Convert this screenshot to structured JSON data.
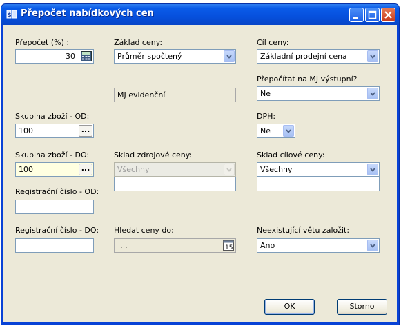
{
  "window": {
    "title": "Přepočet nabídkových cen"
  },
  "colors": {
    "titlebar": "#0650dd",
    "client_bg": "#ece9d8",
    "field_border": "#7f9db9",
    "highlight_field": "#ffffe1"
  },
  "form": {
    "recalc_percent": {
      "label": "Přepočet (%) :",
      "value": "30",
      "button_icon": "calculator-icon"
    },
    "base_price": {
      "label": "Základ ceny:",
      "value": "Průměr spočtený"
    },
    "mj_evidence": {
      "value": "MJ evidenční"
    },
    "target_price": {
      "label": "Cíl ceny:",
      "value": "Základní prodejní cena"
    },
    "recalc_mj": {
      "label": "Přepočítat na MJ výstupní?",
      "value": "Ne"
    },
    "goods_group_from": {
      "label": "Skupina zboží - OD:",
      "value": "100",
      "button": "..."
    },
    "vat": {
      "label": "DPH:",
      "value": "Ne"
    },
    "goods_group_to": {
      "label": "Skupina zboží - DO:",
      "value": "100",
      "button": "..."
    },
    "source_warehouse": {
      "label": "Sklad zdrojové ceny:",
      "value": "Všechny",
      "text": ""
    },
    "target_warehouse": {
      "label": "Sklad cílové ceny:",
      "value": "Všechny",
      "text": ""
    },
    "reg_number_from": {
      "label": "Registrační číslo - OD:",
      "value": ""
    },
    "reg_number_to": {
      "label": "Registrační číslo - DO:",
      "value": ""
    },
    "search_prices_to": {
      "label": "Hledat ceny do:",
      "value": ". .",
      "button_icon": "calendar-icon"
    },
    "nonexistent_row": {
      "label": "Neexistující větu založit:",
      "value": "Ano"
    }
  },
  "buttons": {
    "ok": "OK",
    "cancel": "Storno"
  }
}
